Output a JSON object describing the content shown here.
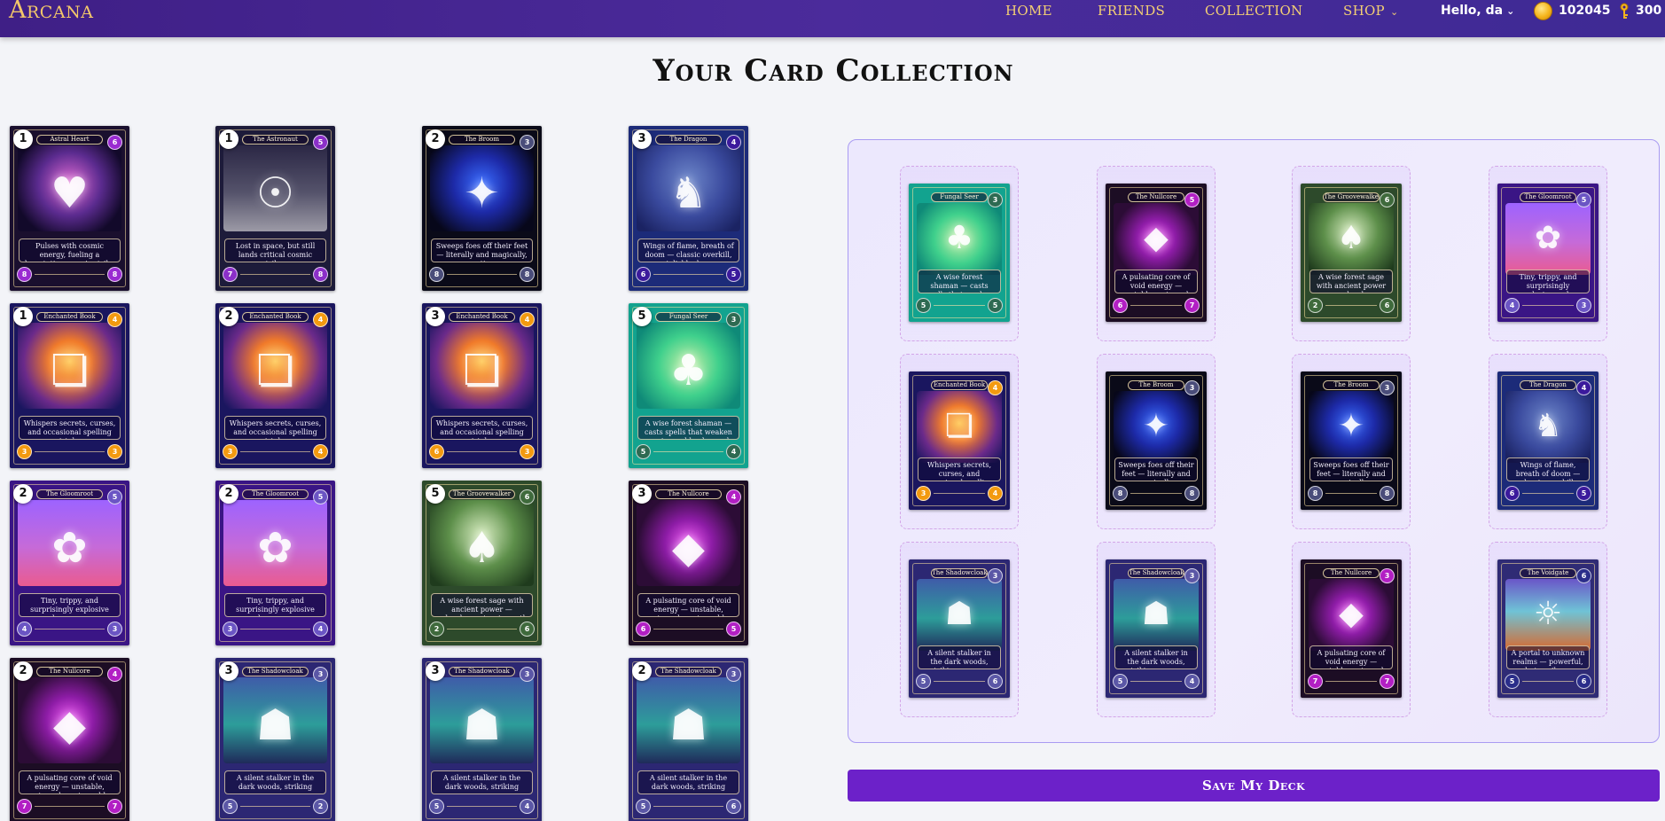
{
  "nav": {
    "logo": "Arcana",
    "links": [
      "HOME",
      "FRIENDS",
      "COLLECTION",
      "SHOP"
    ],
    "shop_chevron": "⌄",
    "greeting": "Hello, da",
    "coins": "102045",
    "keys": "300"
  },
  "page": {
    "title": "Your Card Collection",
    "save_label": "Save My Deck"
  },
  "icons": {
    "coin": "coin-icon",
    "key": "key-icon",
    "chevron": "chevron-down-icon"
  },
  "collection": [
    {
      "qty": "1",
      "name": "Astral Heart",
      "desc": "Pulses with cosmic energy, fueling a devastating cosmic strike.",
      "theme": "astral",
      "cost": "6",
      "l": "8",
      "r": "8"
    },
    {
      "qty": "1",
      "name": "The Astronaut",
      "desc": "Lost in space, but still lands critical cosmic strikes.",
      "theme": "astronaut",
      "cost": "5",
      "l": "7",
      "r": "8"
    },
    {
      "qty": "2",
      "name": "The Broom",
      "desc": "Sweeps foes off their feet — literally and magically, sometimes.",
      "theme": "broom",
      "cost": "3",
      "l": "8",
      "r": "8"
    },
    {
      "qty": "3",
      "name": "The Dragon",
      "desc": "Wings of flame, breath of doom — classic overkill, stylishly done.",
      "theme": "dragon",
      "cost": "4",
      "l": "6",
      "r": "5"
    },
    {
      "qty": "1",
      "name": "Enchanted Book",
      "desc": "Whispers secrets, curses, and occasional spelling mistakes.",
      "theme": "book",
      "cost": "4",
      "l": "3",
      "r": "3"
    },
    {
      "qty": "2",
      "name": "Enchanted Book",
      "desc": "Whispers secrets, curses, and occasional spelling mistakes.",
      "theme": "book",
      "cost": "4",
      "l": "3",
      "r": "4"
    },
    {
      "qty": "3",
      "name": "Enchanted Book",
      "desc": "Whispers secrets, curses, and occasional spelling mistakes.",
      "theme": "book",
      "cost": "4",
      "l": "6",
      "r": "3"
    },
    {
      "qty": "5",
      "name": "Fungal Seer",
      "desc": "A wise forest shaman — casts spells that weaken enemies and heals nearby allies.",
      "theme": "fungal",
      "cost": "3",
      "l": "5",
      "r": "4"
    },
    {
      "qty": "2",
      "name": "The Gloomroot",
      "desc": "Tiny, trippy, and surprisingly explosive under pressure.",
      "theme": "gloom",
      "cost": "5",
      "l": "4",
      "r": "3"
    },
    {
      "qty": "2",
      "name": "The Gloomroot",
      "desc": "Tiny, trippy, and surprisingly explosive under pressure.",
      "theme": "gloom",
      "cost": "5",
      "l": "3",
      "r": "4"
    },
    {
      "qty": "5",
      "name": "The Groovewalker",
      "desc": "A wise forest sage with ancient power — unleashes nature's wrath to weaken enemies and heal allies.",
      "theme": "groove",
      "cost": "6",
      "l": "2",
      "r": "6"
    },
    {
      "qty": "3",
      "name": "The Nullcore",
      "desc": "A pulsating core of void energy — unstable, untamed, unstoppable",
      "theme": "null",
      "cost": "4",
      "l": "6",
      "r": "5"
    },
    {
      "qty": "2",
      "name": "The Nullcore",
      "desc": "A pulsating core of void energy — unstable, untamed, unstoppable",
      "theme": "null",
      "cost": "4",
      "l": "7",
      "r": "7"
    },
    {
      "qty": "3",
      "name": "The Shadowcloak",
      "desc": "A silent stalker in the dark woods, striking unseen.",
      "theme": "shadow",
      "cost": "3",
      "l": "5",
      "r": "2"
    },
    {
      "qty": "3",
      "name": "The Shadowcloak",
      "desc": "A silent stalker in the dark woods, striking unseen.",
      "theme": "shadow",
      "cost": "3",
      "l": "5",
      "r": "4"
    },
    {
      "qty": "2",
      "name": "The Shadowcloak",
      "desc": "A silent stalker in the dark woods, striking unseen.",
      "theme": "shadow",
      "cost": "3",
      "l": "5",
      "r": "6"
    }
  ],
  "deck": [
    {
      "name": "Fungal Seer",
      "desc": "A wise forest shaman — casts spells that weaken enemies and heals nearby allies.",
      "theme": "fungal",
      "cost": "3",
      "l": "5",
      "r": "5"
    },
    {
      "name": "The Nullcore",
      "desc": "A pulsating core of void energy — unstable, untamed, unstoppable",
      "theme": "null",
      "cost": "5",
      "l": "6",
      "r": "7"
    },
    {
      "name": "The Groovewalker",
      "desc": "A wise forest sage with ancient power — unleashes nature's wrath to weaken enemies and heal allies.",
      "theme": "groove",
      "cost": "6",
      "l": "2",
      "r": "6"
    },
    {
      "name": "The Gloomroot",
      "desc": "Tiny, trippy, and surprisingly explosive under pressure.",
      "theme": "gloom",
      "cost": "5",
      "l": "4",
      "r": "3"
    },
    {
      "name": "Enchanted Book",
      "desc": "Whispers secrets, curses, and occasional spelling mistakes.",
      "theme": "book",
      "cost": "4",
      "l": "3",
      "r": "4"
    },
    {
      "name": "The Broom",
      "desc": "Sweeps foes off their feet — literally and magically, sometimes.",
      "theme": "broom",
      "cost": "3",
      "l": "8",
      "r": "8"
    },
    {
      "name": "The Broom",
      "desc": "Sweeps foes off their feet — literally and magically, sometimes.",
      "theme": "broom",
      "cost": "3",
      "l": "8",
      "r": "8"
    },
    {
      "name": "The Dragon",
      "desc": "Wings of flame, breath of doom — classic overkill, stylishly done.",
      "theme": "dragon",
      "cost": "4",
      "l": "6",
      "r": "5"
    },
    {
      "name": "The Shadowcloak",
      "desc": "A silent stalker in the dark woods, striking unseen.",
      "theme": "shadow",
      "cost": "3",
      "l": "5",
      "r": "6"
    },
    {
      "name": "The Shadowcloak",
      "desc": "A silent stalker in the dark woods, striking unseen.",
      "theme": "shadow",
      "cost": "3",
      "l": "5",
      "r": "4"
    },
    {
      "name": "The Nullcore",
      "desc": "A pulsating core of void energy — unstable, untamed, unstoppable",
      "theme": "null",
      "cost": "3",
      "l": "7",
      "r": "7"
    },
    {
      "name": "The Voidgate",
      "desc": "A portal to unknown realms — powerful, but perilous.",
      "theme": "voidgate",
      "cost": "6",
      "l": "5",
      "r": "6"
    }
  ],
  "themes": {
    "astral": {
      "bg": "#1a0f2e",
      "art": "radial-gradient(circle at 50% 45%, #e36bd5 0%, #5b2b8f 45%, #12092a 80%)",
      "cost": "#9a2bd1",
      "glyph": "♥"
    },
    "astronaut": {
      "bg": "#1d1b3a",
      "art": "linear-gradient(180deg, #2b2745 0%, #55536b 55%, #9c9aa6 100%)",
      "cost": "#8b2fc9",
      "glyph": "☉"
    },
    "broom": {
      "bg": "#0a0a18",
      "art": "radial-gradient(circle at 50% 45%, #3a6dff 0%, #1d2aa8 40%, #07071a 85%)",
      "cost": "#4a4d7a",
      "glyph": "✦"
    },
    "dragon": {
      "bg": "#1c2b79",
      "art": "radial-gradient(circle at 50% 40%, #6d86c9 0%, #3a4a9e 50%, #1b2363 90%)",
      "cost": "#3b1a9c",
      "glyph": "♞"
    },
    "book": {
      "bg": "#1a165f",
      "art": "radial-gradient(circle at 50% 45%, #ffcf66 0%, #f07a2a 30%, #6b2a8a 65%, #1a165f 95%)",
      "cost": "#f39a10",
      "glyph": "❏"
    },
    "fungal": {
      "bg": "#12a38f",
      "art": "radial-gradient(circle at 50% 50%, #c8f0a8 0%, #3fd08c 45%, #0f8a78 85%)",
      "cost": "#2e6a52",
      "glyph": "♣"
    },
    "gloom": {
      "bg": "#3a1585",
      "art": "linear-gradient(180deg, #9d63ff 0%, #c66ad8 55%, #ea5b8f 100%)",
      "cost": "#6b55c4",
      "glyph": "✿"
    },
    "groove": {
      "bg": "#2d4a2b",
      "art": "radial-gradient(circle at 50% 40%, #d7ecc0 0%, #5d8f4a 45%, #1f3b1d 90%)",
      "cost": "#3f6a3c",
      "glyph": "♠"
    },
    "null": {
      "bg": "#1c0d24",
      "art": "radial-gradient(circle at 50% 50%, #f05cf5 0%, #8d1ca6 35%, #2c0c36 75%)",
      "cost": "#b21fc4",
      "glyph": "◆"
    },
    "shadow": {
      "bg": "#2c2773",
      "art": "linear-gradient(180deg, #3f5ca9 0%, #2d9d9a 55%, #1f2a5a 100%)",
      "cost": "#5b57a6",
      "glyph": "☗"
    },
    "voidgate": {
      "bg": "#2f2b75",
      "art": "linear-gradient(180deg, #6a56c8 0%, #6fc3d6 45%, #d8692e 100%)",
      "cost": "#2a2d8a",
      "glyph": "☼"
    }
  },
  "stat_colors": {
    "left": "#3a2a8a",
    "right": "#3a2a8a"
  }
}
